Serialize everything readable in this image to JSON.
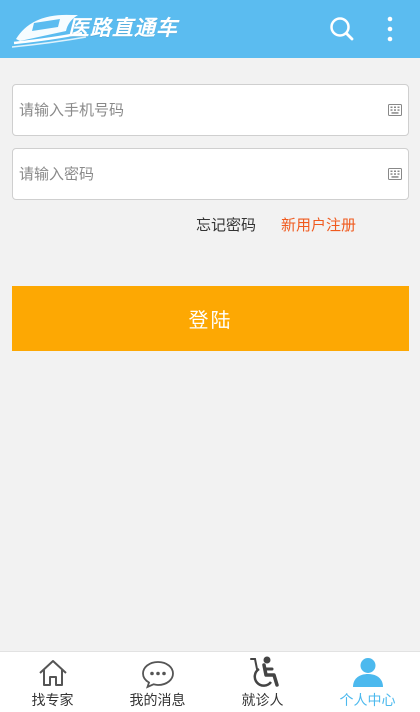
{
  "header": {
    "app_title": "医路直通车",
    "brand_color": "#5bbcf0",
    "icons": [
      "train-logo-icon",
      "search-icon",
      "more-vertical-icon"
    ]
  },
  "login": {
    "phone_placeholder": "请输入手机号码",
    "phone_value": "",
    "password_placeholder": "请输入密码",
    "password_value": "",
    "forgot_label": "忘记密码",
    "register_label": "新用户注册",
    "register_color": "#f05a1e",
    "submit_label": "登陆",
    "submit_color": "#fda803",
    "field_icon": "keyboard-icon"
  },
  "tabbar": {
    "active_color": "#4cb9ee",
    "items": [
      {
        "label": "找专家",
        "icon": "home-icon",
        "active": false
      },
      {
        "label": "我的消息",
        "icon": "chat-bubble-icon",
        "active": false
      },
      {
        "label": "就诊人",
        "icon": "wheelchair-icon",
        "active": false
      },
      {
        "label": "个人中心",
        "icon": "person-icon",
        "active": true
      }
    ]
  }
}
